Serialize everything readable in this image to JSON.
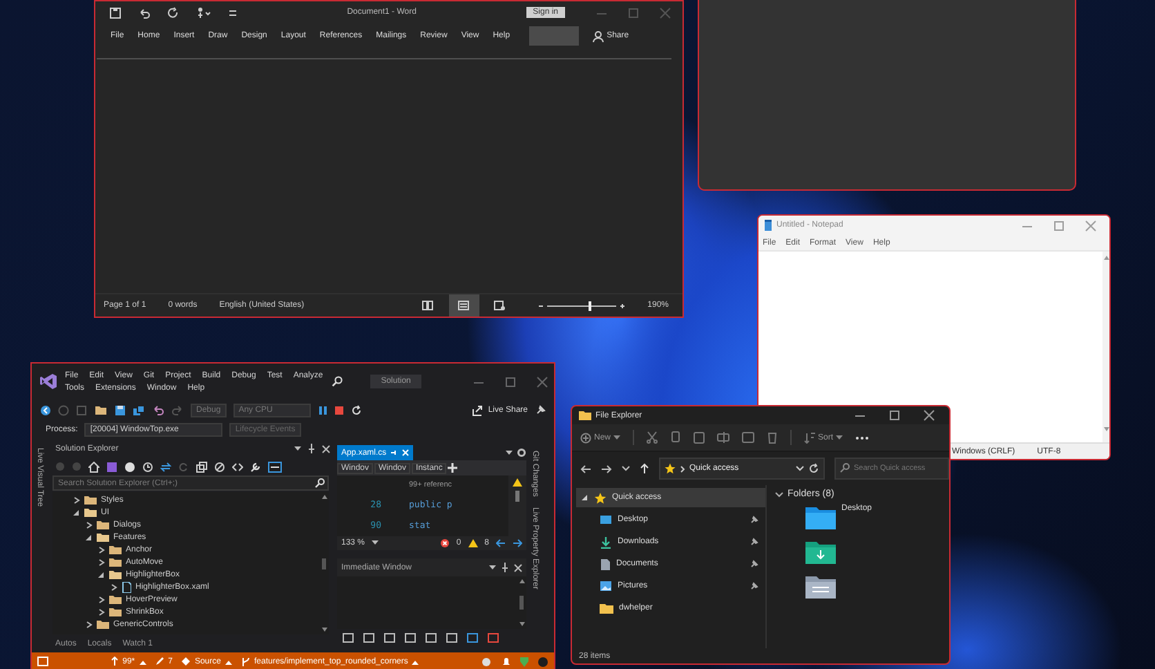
{
  "word": {
    "title": "Document1 - Word",
    "sign_in": "Sign in",
    "ribbon_tabs": [
      "File",
      "Home",
      "Insert",
      "Draw",
      "Design",
      "Layout",
      "References",
      "Mailings",
      "Review",
      "View",
      "Help"
    ],
    "share": "Share",
    "status_items": [
      "Page 1 of 1",
      "0 words",
      "English (United States)"
    ],
    "views": [
      {
        "kind": "read",
        "selected": false
      },
      {
        "kind": "print",
        "selected": true
      },
      {
        "kind": "web",
        "selected": false
      }
    ],
    "zoom": {
      "level": 0.6,
      "reading": "190%"
    }
  },
  "notepad": {
    "title": "Untitled - Notepad",
    "menu": [
      "File",
      "Edit",
      "Format",
      "View",
      "Help"
    ],
    "status_items": [
      "Windows (CRLF)",
      "UTF-8"
    ]
  },
  "visual_studio": {
    "menu_rows": [
      [
        "File",
        "Edit",
        "View",
        "Git",
        "Project",
        "Build",
        "Debug",
        "Test",
        "Analyze"
      ],
      [
        "Tools",
        "Extensions",
        "Window",
        "Help"
      ]
    ],
    "search_box": "Solution",
    "configuration": "Debug",
    "platform": "Any CPU",
    "live_share": "Live Share",
    "process_label": "Process:",
    "process": "[20004] WindowTop.exe",
    "lifecycle": "Lifecycle Events",
    "left_side_tabs": [
      "Live Visual Tree"
    ],
    "solution_explorer": {
      "title": "Solution Explorer",
      "search_placeholder": "Search Solution Explorer (Ctrl+;)",
      "tree": [
        {
          "label": "Styles",
          "kind": "folder",
          "expanded": false
        },
        {
          "label": "UI",
          "kind": "folder",
          "expanded": true,
          "children": [
            {
              "label": "Dialogs",
              "kind": "folder",
              "expanded": false
            },
            {
              "label": "Features",
              "kind": "folder",
              "expanded": true,
              "children": [
                {
                  "label": "Anchor",
                  "kind": "folder",
                  "expanded": false
                },
                {
                  "label": "AutoMove",
                  "kind": "folder",
                  "expanded": false
                },
                {
                  "label": "HighlighterBox",
                  "kind": "folder",
                  "expanded": true,
                  "children": [
                    {
                      "label": "HighlighterBox.xaml",
                      "kind": "file",
                      "expanded": false
                    }
                  ]
                },
                {
                  "label": "HoverPreview",
                  "kind": "folder",
                  "expanded": false
                },
                {
                  "label": "ShrinkBox",
                  "kind": "folder",
                  "expanded": false
                }
              ]
            },
            {
              "label": "GenericControls",
              "kind": "folder",
              "expanded": false
            }
          ]
        }
      ]
    },
    "editor": {
      "tab": "App.xaml.cs",
      "nav_dropdowns": [
        "Windov",
        "Windov",
        "Instanc"
      ],
      "code_lines": [
        {
          "text": "99+ referenc"
        },
        {
          "number": "28",
          "text": "public p"
        },
        {
          "number": "90",
          "text": "stat"
        }
      ],
      "zoom": "133 %",
      "errors": "0",
      "warnings": "8"
    },
    "immediate_window": {
      "title": "Immediate Window"
    },
    "right_side_tabs": [
      "Git Changes",
      "Live Property Explorer"
    ],
    "bottom_tabs": [
      "Autos",
      "Locals",
      "Watch 1"
    ],
    "status_bar": [
      {
        "kind": "pushes",
        "text": "99*"
      },
      {
        "kind": "edits",
        "text": "7"
      },
      {
        "kind": "repo",
        "text": "Source"
      },
      {
        "kind": "branch",
        "text": "features/implement_top_rounded_corners"
      }
    ]
  },
  "file_explorer": {
    "title": "File Explorer",
    "new_button": "New",
    "sort_button": "Sort",
    "address": "Quick access",
    "search_placeholder": "Search Quick access",
    "nav_tree": [
      {
        "label": "Quick access",
        "kind": "star",
        "expanded": true,
        "selected": true,
        "children": [
          {
            "label": "Desktop",
            "kind": "desktop",
            "pinned": true,
            "selected": false
          },
          {
            "label": "Downloads",
            "kind": "downloads",
            "pinned": true,
            "selected": false
          },
          {
            "label": "Documents",
            "kind": "documents",
            "pinned": true,
            "selected": false
          },
          {
            "label": "Pictures",
            "kind": "pictures",
            "pinned": true,
            "selected": false
          },
          {
            "label": "dwhelper",
            "kind": "folder",
            "pinned": false,
            "selected": false
          }
        ]
      }
    ],
    "section": "Folders (8)",
    "folders": [
      {
        "name": "Desktop",
        "kind": "desktop"
      },
      {
        "kind": "downloads"
      },
      {
        "kind": "documents"
      }
    ],
    "status": "28 items"
  }
}
